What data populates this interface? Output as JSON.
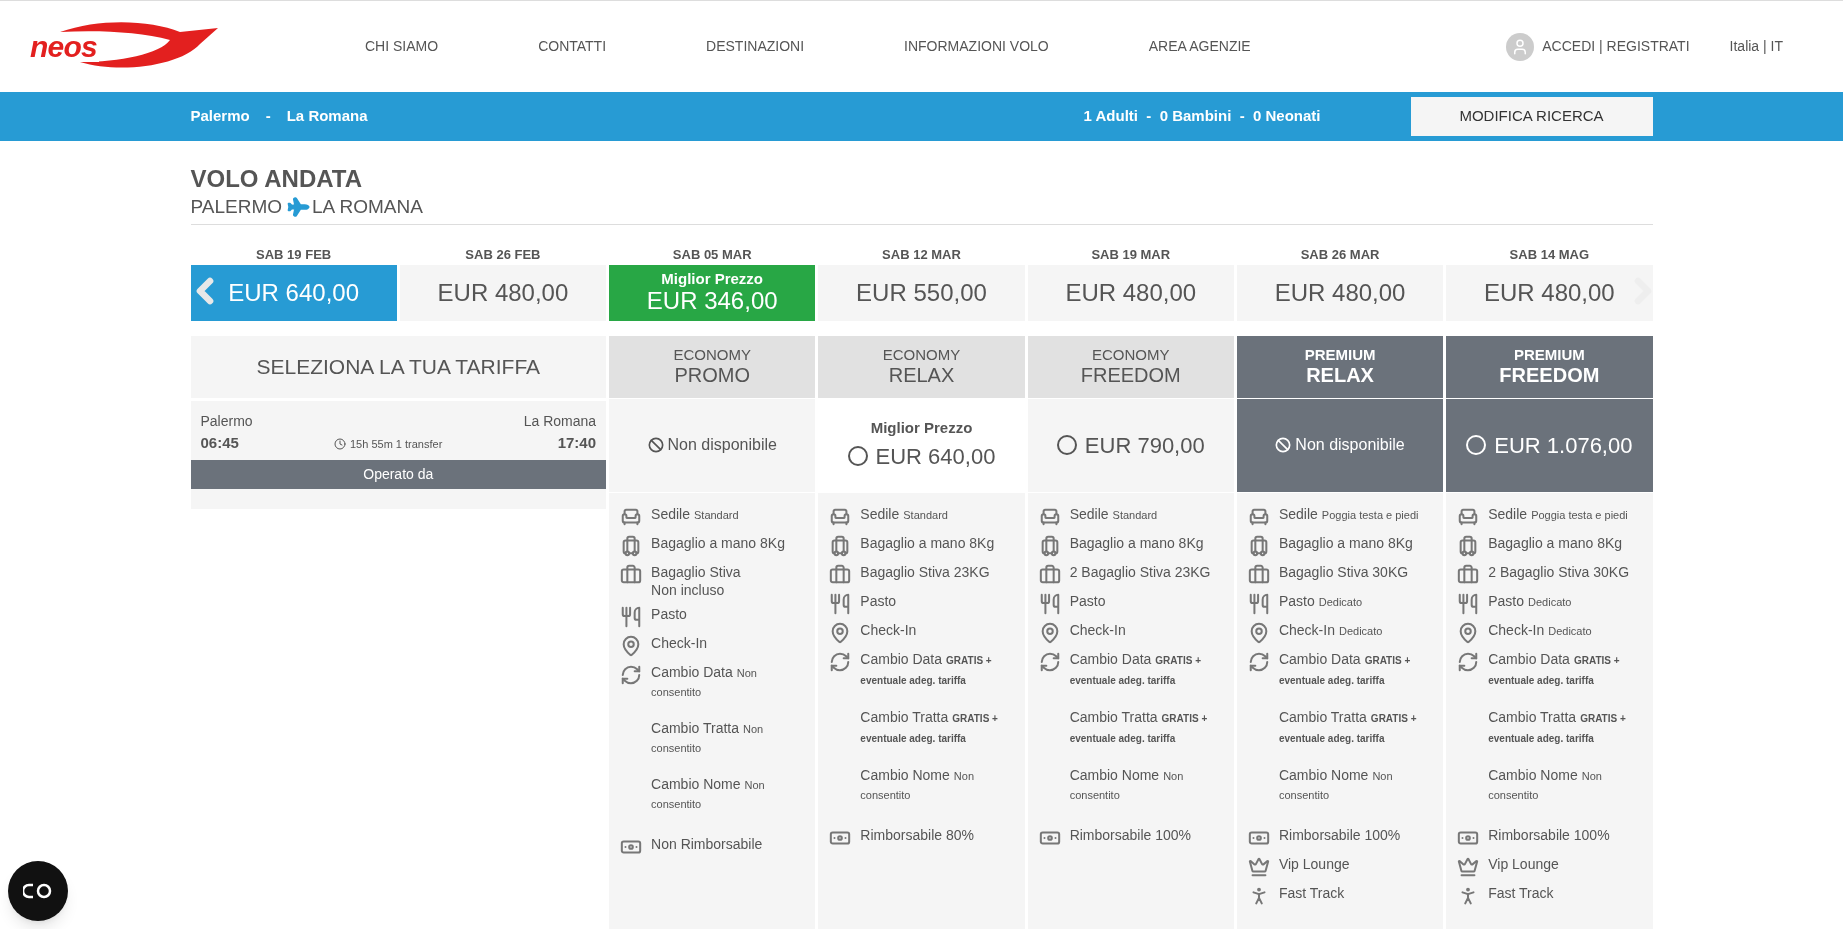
{
  "header": {
    "logo": "neos",
    "nav": [
      "CHI SIAMO",
      "CONTATTI",
      "DESTINAZIONI",
      "INFORMAZIONI VOLO",
      "AREA AGENZIE"
    ],
    "account": "ACCEDI | REGISTRATI",
    "language": "Italia | IT"
  },
  "search_bar": {
    "origin": "Palermo",
    "separator": "-",
    "destination": "La Romana",
    "passengers": "1 Adulti  -  0 Bambini  -  0 Neonati",
    "button": "MODIFICA RICERCA"
  },
  "flight": {
    "title": "VOLO ANDATA",
    "origin": "PALERMO",
    "destination": "LA ROMANA"
  },
  "dates": [
    {
      "day": "SAB 19 FEB",
      "price": "EUR 640,00",
      "selected": true
    },
    {
      "day": "SAB 26 FEB",
      "price": "EUR 480,00",
      "selected": false
    },
    {
      "day": "SAB 05 MAR",
      "price": "EUR 346,00",
      "selected": false,
      "badge": "Miglior Prezzo"
    },
    {
      "day": "SAB 12 MAR",
      "price": "EUR 550,00",
      "selected": false
    },
    {
      "day": "SAB 19 MAR",
      "price": "EUR 480,00",
      "selected": false
    },
    {
      "day": "SAB 26 MAR",
      "price": "EUR 480,00",
      "selected": false
    },
    {
      "day": "SAB 14 MAG",
      "price": "EUR 480,00",
      "selected": false
    }
  ],
  "fare_panel": {
    "title": "SELEZIONA LA TUA TARIFFA",
    "from": "Palermo",
    "departure": "06:45",
    "duration": "15h 55m 1 transfer",
    "to": "La Romana",
    "arrival": "17:40",
    "operator": "Operato da"
  },
  "fares": [
    {
      "tier": "ECONOMY",
      "name": "PROMO",
      "kind": "economy",
      "offer": {
        "kind": "unavailable",
        "text": "Non disponibile"
      },
      "features": [
        {
          "kind": "seat",
          "label": "Sedile",
          "detail": "Standard"
        },
        {
          "kind": "cabin-bag",
          "label": "Bagaglio a mano 8Kg"
        },
        {
          "kind": "hold-bag",
          "label": "Bagaglio Stiva",
          "detail": "Non incluso",
          "block": true
        },
        {
          "kind": "meal",
          "label": "Pasto"
        },
        {
          "kind": "checkin",
          "label": "Check-In"
        },
        {
          "kind": "change",
          "label": "Cambio Data",
          "detail": "Non consentito"
        },
        {
          "kind": "blank",
          "label": "Cambio Tratta",
          "detail": "Non consentito"
        },
        {
          "kind": "blank",
          "label": "Cambio Nome",
          "detail": "Non consentito"
        },
        {
          "kind": "refund",
          "label": "Non Rimborsabile"
        }
      ]
    },
    {
      "tier": "ECONOMY",
      "name": "RELAX",
      "kind": "economy",
      "offer": {
        "kind": "price",
        "badge": "Miglior Prezzo",
        "text": "EUR 640,00",
        "selected": false
      },
      "features": [
        {
          "kind": "seat",
          "label": "Sedile",
          "detail": "Standard"
        },
        {
          "kind": "cabin-bag",
          "label": "Bagaglio a mano 8Kg"
        },
        {
          "kind": "hold-bag",
          "label": "Bagaglio Stiva 23KG"
        },
        {
          "kind": "meal",
          "label": "Pasto"
        },
        {
          "kind": "checkin",
          "label": "Check-In"
        },
        {
          "kind": "change",
          "label": "Cambio Data",
          "detail": "GRATIS + eventuale adeg. tariffa",
          "bold": true
        },
        {
          "kind": "blank",
          "label": "Cambio Tratta",
          "detail": "GRATIS + eventuale adeg. tariffa",
          "bold": true
        },
        {
          "kind": "blank",
          "label": "Cambio Nome",
          "detail": "Non consentito"
        },
        {
          "kind": "refund",
          "label": "Rimborsabile 80%"
        }
      ]
    },
    {
      "tier": "ECONOMY",
      "name": "FREEDOM",
      "kind": "economy",
      "offer": {
        "kind": "price",
        "text": "EUR 790,00",
        "selected": false
      },
      "features": [
        {
          "kind": "seat",
          "label": "Sedile",
          "detail": "Standard"
        },
        {
          "kind": "cabin-bag",
          "label": "Bagaglio a mano 8Kg"
        },
        {
          "kind": "hold-bag",
          "label": "2 Bagaglio Stiva 23KG"
        },
        {
          "kind": "meal",
          "label": "Pasto"
        },
        {
          "kind": "checkin",
          "label": "Check-In"
        },
        {
          "kind": "change",
          "label": "Cambio Data",
          "detail": "GRATIS + eventuale adeg. tariffa",
          "bold": true
        },
        {
          "kind": "blank",
          "label": "Cambio Tratta",
          "detail": "GRATIS + eventuale adeg. tariffa",
          "bold": true
        },
        {
          "kind": "blank",
          "label": "Cambio Nome",
          "detail": "Non consentito"
        },
        {
          "kind": "refund",
          "label": "Rimborsabile 100%"
        }
      ]
    },
    {
      "tier": "PREMIUM",
      "name": "RELAX",
      "kind": "premium",
      "offer": {
        "kind": "unavailable",
        "text": "Non disponibile"
      },
      "features": [
        {
          "kind": "seat",
          "label": "Sedile",
          "detail": "Poggia testa e piedi"
        },
        {
          "kind": "cabin-bag",
          "label": "Bagaglio a mano 8Kg"
        },
        {
          "kind": "hold-bag",
          "label": "Bagaglio Stiva 30KG"
        },
        {
          "kind": "meal",
          "label": "Pasto",
          "detail": "Dedicato"
        },
        {
          "kind": "checkin",
          "label": "Check-In",
          "detail": "Dedicato"
        },
        {
          "kind": "change",
          "label": "Cambio Data",
          "detail": "GRATIS + eventuale adeg. tariffa",
          "bold": true
        },
        {
          "kind": "blank",
          "label": "Cambio Tratta",
          "detail": "GRATIS + eventuale adeg. tariffa",
          "bold": true
        },
        {
          "kind": "blank",
          "label": "Cambio Nome",
          "detail": "Non consentito"
        },
        {
          "kind": "refund",
          "label": "Rimborsabile 100%"
        },
        {
          "kind": "lounge",
          "label": "Vip Lounge"
        },
        {
          "kind": "fast-track",
          "label": "Fast Track"
        }
      ]
    },
    {
      "tier": "PREMIUM",
      "name": "FREEDOM",
      "kind": "premium",
      "offer": {
        "kind": "price",
        "text": "EUR 1.076,00",
        "selected": false
      },
      "features": [
        {
          "kind": "seat",
          "label": "Sedile",
          "detail": "Poggia testa e piedi"
        },
        {
          "kind": "cabin-bag",
          "label": "Bagaglio a mano 8Kg"
        },
        {
          "kind": "hold-bag",
          "label": "2 Bagaglio Stiva 30KG"
        },
        {
          "kind": "meal",
          "label": "Pasto",
          "detail": "Dedicato"
        },
        {
          "kind": "checkin",
          "label": "Check-In",
          "detail": "Dedicato"
        },
        {
          "kind": "change",
          "label": "Cambio Data",
          "detail": "GRATIS + eventuale adeg. tariffa",
          "bold": true
        },
        {
          "kind": "blank",
          "label": "Cambio Tratta",
          "detail": "GRATIS + eventuale adeg. tariffa",
          "bold": true
        },
        {
          "kind": "blank",
          "label": "Cambio Nome",
          "detail": "Non consentito"
        },
        {
          "kind": "refund",
          "label": "Rimborsabile 100%"
        },
        {
          "kind": "lounge",
          "label": "Vip Lounge"
        },
        {
          "kind": "fast-track",
          "label": "Fast Track"
        }
      ]
    }
  ]
}
